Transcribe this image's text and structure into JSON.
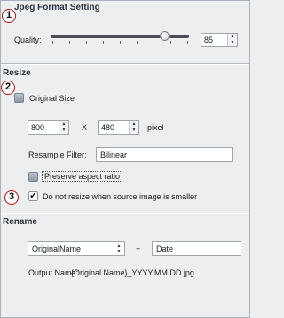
{
  "jpeg_section": {
    "title": "Jpeg Format Setting",
    "badge": "1",
    "quality_label": "Quality:",
    "quality_value": "85",
    "quality_percent": 85
  },
  "resize_section": {
    "title": "Resize",
    "badge": "2",
    "original_size_label": "Original Size",
    "width_value": "800",
    "x_label": "X",
    "height_value": "480",
    "unit_label": "pixel",
    "resample_label": "Resample Filter:",
    "resample_value": "Bilinear",
    "preserve_label": "Preserve aspect ratio",
    "badge3": "3",
    "no_resize_label": "Do not resize when source image is smaller",
    "no_resize_check": "✔"
  },
  "rename_section": {
    "title": "Rename",
    "name_option": "OriginalName",
    "plus_label": "+",
    "suffix_value": "Date",
    "output_label": "Output Name:",
    "output_value": "{Original Name}_YYYY.MM.DD.jpg"
  },
  "icons": {
    "spin_up": "▲",
    "spin_down": "▼"
  }
}
